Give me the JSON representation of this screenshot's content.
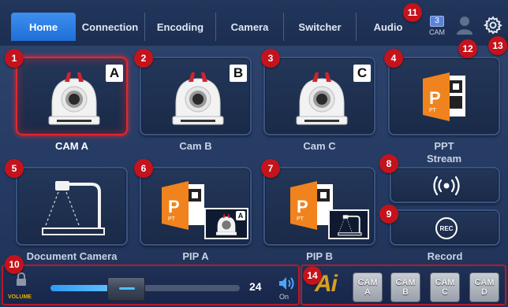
{
  "nav": {
    "tabs": [
      {
        "label": "Home",
        "active": true
      },
      {
        "label": "Connection"
      },
      {
        "label": "Encoding"
      },
      {
        "label": "Camera"
      },
      {
        "label": "Switcher"
      },
      {
        "label": "Audio"
      }
    ],
    "cam_count": "3",
    "cam_count_label": "CAM"
  },
  "badges": [
    "1",
    "2",
    "3",
    "4",
    "5",
    "6",
    "7",
    "8",
    "9",
    "10",
    "11",
    "12",
    "13",
    "14"
  ],
  "tiles": {
    "cam_a": {
      "label": "CAM A",
      "letter": "A"
    },
    "cam_b": {
      "label": "Cam B",
      "letter": "B"
    },
    "cam_c": {
      "label": "Cam C",
      "letter": "C"
    },
    "ppt": {
      "label_line1": "PPT",
      "label_line2": "Stream"
    },
    "document_camera": {
      "label": "Document Camera"
    },
    "pip_a": {
      "label": "PIP A",
      "letter": "A"
    },
    "pip_b": {
      "label": "PIP B"
    },
    "stream_button": {
      "icon": "broadcast-icon"
    },
    "record": {
      "label": "Record",
      "button_text": "REC"
    }
  },
  "volume": {
    "lock_label": "VOLUME",
    "level": 24,
    "level_text": "24",
    "max": 60,
    "speaker_state": "On"
  },
  "switcher": {
    "ai_label": "Ai",
    "cam_buttons": [
      {
        "line1": "CAM",
        "line2": "A"
      },
      {
        "line1": "CAM",
        "line2": "B"
      },
      {
        "line1": "CAM",
        "line2": "C"
      },
      {
        "line1": "CAM",
        "line2": "D"
      }
    ]
  },
  "colors": {
    "accent": "#1f6fd6",
    "badge": "#c4131c",
    "selected_border": "#e0282f",
    "ppt_orange": "#f0831e"
  }
}
